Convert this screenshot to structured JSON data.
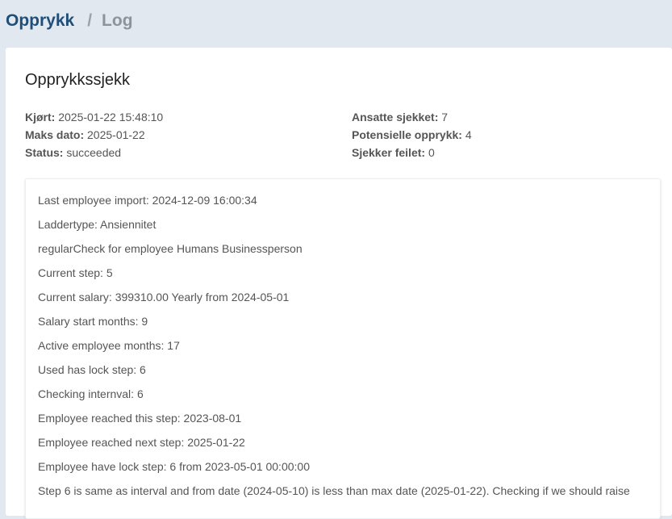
{
  "breadcrumb": {
    "root": "Opprykk",
    "separator": "/",
    "current": "Log"
  },
  "card": {
    "title": "Opprykkssjekk",
    "summary_left": [
      {
        "label": "Kjørt:",
        "value": "2025-01-22 15:48:10"
      },
      {
        "label": "Maks dato:",
        "value": "2025-01-22"
      },
      {
        "label": "Status:",
        "value": "succeeded"
      }
    ],
    "summary_right": [
      {
        "label": "Ansatte sjekket:",
        "value": "7"
      },
      {
        "label": "Potensielle opprykk:",
        "value": "4"
      },
      {
        "label": "Sjekker feilet:",
        "value": "0"
      }
    ]
  },
  "log": {
    "lines": [
      "Last employee import: 2024-12-09 16:00:34",
      "Laddertype: Ansiennitet",
      "regularCheck for employee Humans Businessperson",
      "Current step: 5",
      "Current salary: 399310.00 Yearly from 2024-05-01",
      "Salary start months: 9",
      "Active employee months: 17",
      "Used has lock step: 6",
      "Checking internval: 6",
      "Employee reached this step: 2023-08-01",
      "Employee reached next step: 2025-01-22",
      "Employee have lock step: 6 from 2023-05-01 00:00:00",
      "Step 6 is same as interval and from date (2024-05-10) is less than max date (2025-01-22). Checking if we should raise"
    ]
  }
}
